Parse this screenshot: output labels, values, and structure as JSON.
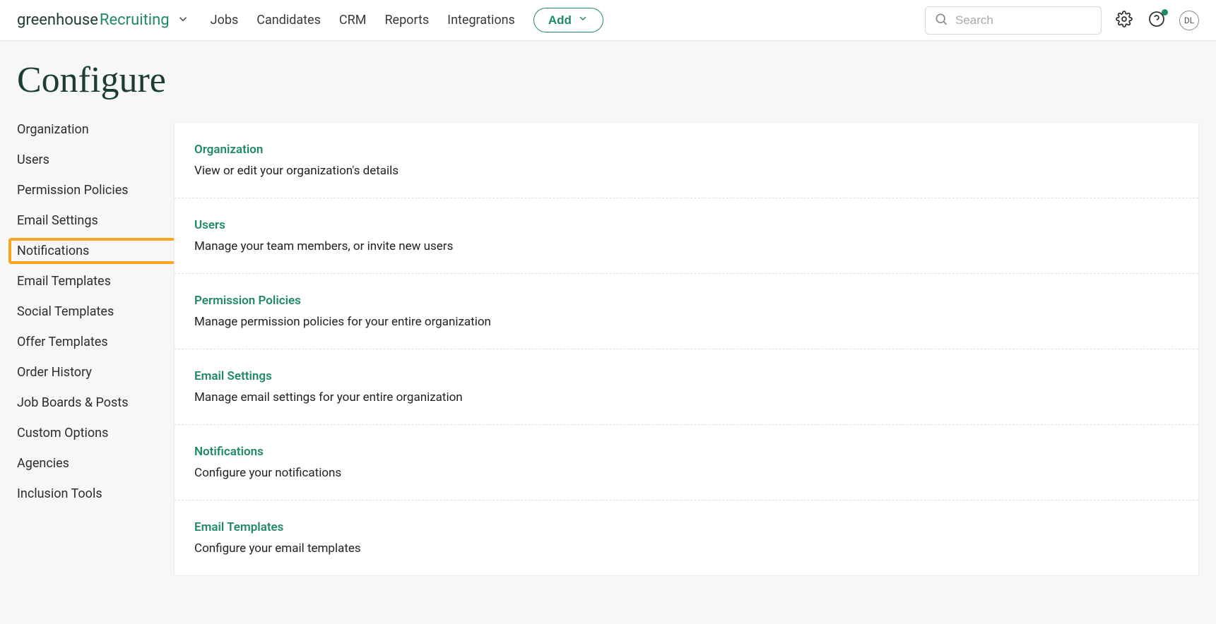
{
  "brand": {
    "word1": "greenhouse",
    "word2": "Recruiting"
  },
  "nav": {
    "items": [
      "Jobs",
      "Candidates",
      "CRM",
      "Reports",
      "Integrations"
    ],
    "add_label": "Add"
  },
  "search": {
    "placeholder": "Search"
  },
  "avatar_initials": "DL",
  "page_title": "Configure",
  "sidebar": {
    "items": [
      {
        "label": "Organization",
        "highlighted": false
      },
      {
        "label": "Users",
        "highlighted": false
      },
      {
        "label": "Permission Policies",
        "highlighted": false
      },
      {
        "label": "Email Settings",
        "highlighted": false
      },
      {
        "label": "Notifications",
        "highlighted": true
      },
      {
        "label": "Email Templates",
        "highlighted": false
      },
      {
        "label": "Social Templates",
        "highlighted": false
      },
      {
        "label": "Offer Templates",
        "highlighted": false
      },
      {
        "label": "Order History",
        "highlighted": false
      },
      {
        "label": "Job Boards & Posts",
        "highlighted": false
      },
      {
        "label": "Custom Options",
        "highlighted": false
      },
      {
        "label": "Agencies",
        "highlighted": false
      },
      {
        "label": "Inclusion Tools",
        "highlighted": false
      }
    ]
  },
  "sections": [
    {
      "title": "Organization",
      "desc": "View or edit your organization's details"
    },
    {
      "title": "Users",
      "desc": "Manage your team members, or invite new users"
    },
    {
      "title": "Permission Policies",
      "desc": "Manage permission policies for your entire organization"
    },
    {
      "title": "Email Settings",
      "desc": "Manage email settings for your entire organization"
    },
    {
      "title": "Notifications",
      "desc": "Configure your notifications"
    },
    {
      "title": "Email Templates",
      "desc": "Configure your email templates"
    }
  ]
}
